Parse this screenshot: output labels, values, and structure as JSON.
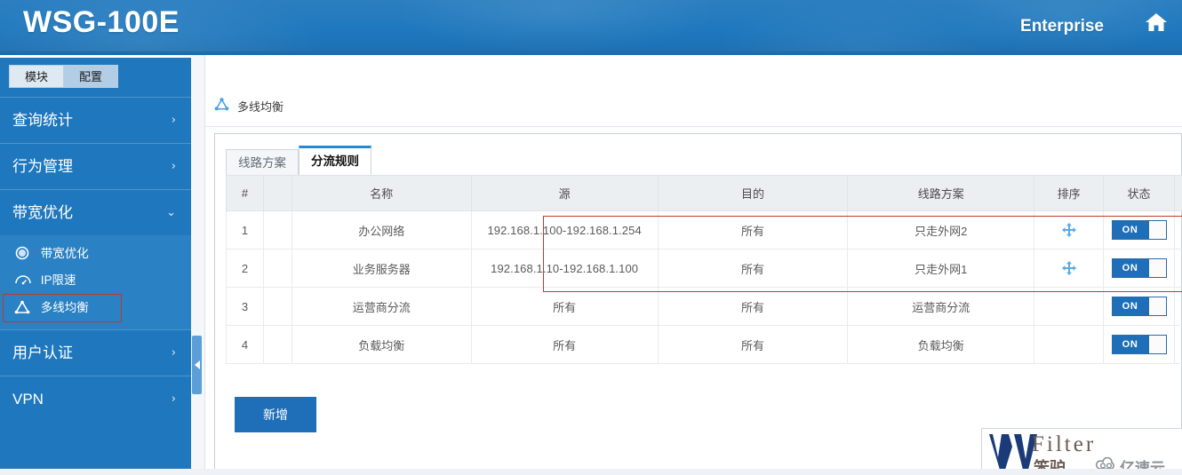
{
  "header": {
    "brand": "WSG-100E",
    "edition": "Enterprise",
    "home_icon": "home-icon"
  },
  "sidebar": {
    "module_tabs": [
      {
        "label": "模块",
        "active": true
      },
      {
        "label": "配置",
        "active": false
      }
    ],
    "items": [
      {
        "label": "查询统计",
        "chevron": "›",
        "expanded": false
      },
      {
        "label": "行为管理",
        "chevron": "›",
        "expanded": false
      },
      {
        "label": "带宽优化",
        "chevron": "⌄",
        "expanded": true
      },
      {
        "label": "用户认证",
        "chevron": "›",
        "expanded": false
      },
      {
        "label": "VPN",
        "chevron": "›",
        "expanded": false
      }
    ],
    "sub_items": [
      {
        "label": "带宽优化",
        "icon": "circle-icon",
        "selected": false
      },
      {
        "label": "IP限速",
        "icon": "speedometer-icon",
        "selected": false
      },
      {
        "label": "多线均衡",
        "icon": "triangle-network-icon",
        "selected": true
      }
    ],
    "collapse_handle_icon": "chevron-left-icon"
  },
  "breadcrumb": {
    "icon": "triangle-network-icon",
    "text": "多线均衡"
  },
  "card": {
    "tabs": [
      {
        "label": "线路方案",
        "active": false
      },
      {
        "label": "分流规则",
        "active": true
      }
    ],
    "table": {
      "columns": [
        "#",
        "",
        "名称",
        "源",
        "目的",
        "线路方案",
        "排序",
        "状态",
        ""
      ],
      "rows": [
        {
          "index": "1",
          "pad": "",
          "name": "办公网络",
          "source": "192.168.1.100-192.168.1.254",
          "dest": "所有",
          "plan": "只走外网2",
          "sort_icon": "move-icon",
          "state": "ON"
        },
        {
          "index": "2",
          "pad": "",
          "name": "业务服务器",
          "source": "192.168.1.10-192.168.1.100",
          "dest": "所有",
          "plan": "只走外网1",
          "sort_icon": "move-icon",
          "state": "ON"
        },
        {
          "index": "3",
          "pad": "",
          "name": "运营商分流",
          "source": "所有",
          "dest": "所有",
          "plan": "运营商分流",
          "sort_icon": "",
          "state": "ON"
        },
        {
          "index": "4",
          "pad": "",
          "name": "负载均衡",
          "source": "所有",
          "dest": "所有",
          "plan": "负载均衡",
          "sort_icon": "",
          "state": "ON"
        }
      ]
    },
    "add_button": "新增"
  },
  "watermark": {
    "letter": "W",
    "filter": "Filter",
    "cn": "笨驴",
    "cloud_icon": "cloud-icon",
    "cloud_text": "亿速云"
  },
  "colors": {
    "brand_blue": "#1f78bd",
    "accent_blue": "#2189d6",
    "toggle_on": "#1f6fb8",
    "selection_red": "#c0392b",
    "header_grad_top": "#2b7fc0"
  }
}
